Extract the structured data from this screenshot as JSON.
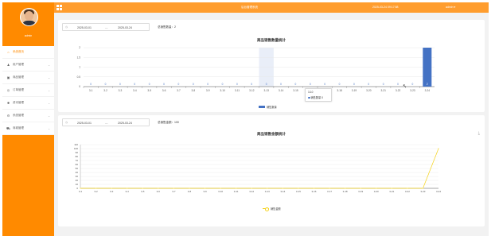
{
  "sidebar": {
    "username": "admin",
    "items": [
      {
        "label": "系统首页",
        "icon": "home-icon",
        "glyph": "⌂",
        "active": true,
        "chevron": false
      },
      {
        "label": "用户管理",
        "icon": "user-icon",
        "glyph": "♟",
        "active": false,
        "chevron": true
      },
      {
        "label": "商品管理",
        "icon": "goods-icon",
        "glyph": "▣",
        "active": false,
        "chevron": true
      },
      {
        "label": "订单管理",
        "icon": "order-icon",
        "glyph": "◎",
        "active": false,
        "chevron": true
      },
      {
        "label": "资讯管理",
        "icon": "news-icon",
        "glyph": "✱",
        "active": false,
        "chevron": true
      },
      {
        "label": "系统管理",
        "icon": "settings-icon",
        "glyph": "⚙",
        "active": false,
        "chevron": true
      },
      {
        "label": "商城管理",
        "icon": "cart-icon",
        "glyph": "⛟",
        "active": false,
        "chevron": true
      }
    ]
  },
  "topbar": {
    "title": "后台管理系统",
    "time": "2025-03-24 09:17:58",
    "user": "admin"
  },
  "card1": {
    "date_start": "2025-03-01",
    "date_sep": "—",
    "date_end": "2025-03-24",
    "stat_label": "总销售数量：",
    "stat_value": "2",
    "chart_title": "商品销售数量统计",
    "legend": "销售数量",
    "tooltip": {
      "date": "3-10",
      "series": "销售数量",
      "value": "0"
    }
  },
  "card2": {
    "date_start": "2025-03-01",
    "date_sep": "—",
    "date_end": "2025-03-24",
    "stat_label": "总销售金额：",
    "stat_value": "100",
    "chart_title": "商品销售金额统计",
    "legend": "销售金额"
  },
  "colors": {
    "sidebar": "#ff8a00",
    "topbar": "#ff9d2e",
    "bar": "#4472c4",
    "line": "#f5d31a"
  },
  "chart_data": [
    {
      "type": "bar",
      "title": "商品销售数量统计",
      "categories": [
        "3-1",
        "3-2",
        "3-3",
        "3-4",
        "3-5",
        "3-6",
        "3-7",
        "3-8",
        "3-9",
        "3-10",
        "3-11",
        "3-12",
        "3-13",
        "3-14",
        "3-15",
        "3-16",
        "3-17",
        "3-18",
        "3-19",
        "3-20",
        "3-21",
        "3-22",
        "3-23",
        "3-24"
      ],
      "series": [
        {
          "name": "销售数量",
          "values": [
            0,
            0,
            0,
            0,
            0,
            0,
            0,
            0,
            0,
            0,
            0,
            0,
            0,
            0,
            0,
            0,
            0,
            0,
            0,
            0,
            0,
            0,
            0,
            2
          ]
        }
      ],
      "ylim": [
        0,
        2
      ],
      "yticks": [
        "0",
        "0.5",
        "1",
        "1.5",
        "2"
      ],
      "highlight_category": "3-13",
      "legend": "bottom"
    },
    {
      "type": "line",
      "title": "商品销售金额统计",
      "categories": [
        "3-1",
        "3-2",
        "3-3",
        "3-4",
        "3-5",
        "3-6",
        "3-7",
        "3-8",
        "3-9",
        "3-10",
        "3-11",
        "3-12",
        "3-13",
        "3-14",
        "3-15",
        "3-16",
        "3-17",
        "3-18",
        "3-19",
        "3-20",
        "3-21",
        "3-22",
        "3-23",
        "3-24"
      ],
      "series": [
        {
          "name": "销售金额",
          "values": [
            0,
            0,
            0,
            0,
            0,
            0,
            0,
            0,
            0,
            0,
            0,
            0,
            0,
            0,
            0,
            0,
            0,
            0,
            0,
            0,
            0,
            0,
            0,
            100
          ]
        }
      ],
      "ylim": [
        0,
        110
      ],
      "yticks": [
        "0",
        "10",
        "20",
        "30",
        "40",
        "50",
        "60",
        "70",
        "80",
        "90",
        "100",
        "110"
      ],
      "legend": "bottom"
    }
  ]
}
